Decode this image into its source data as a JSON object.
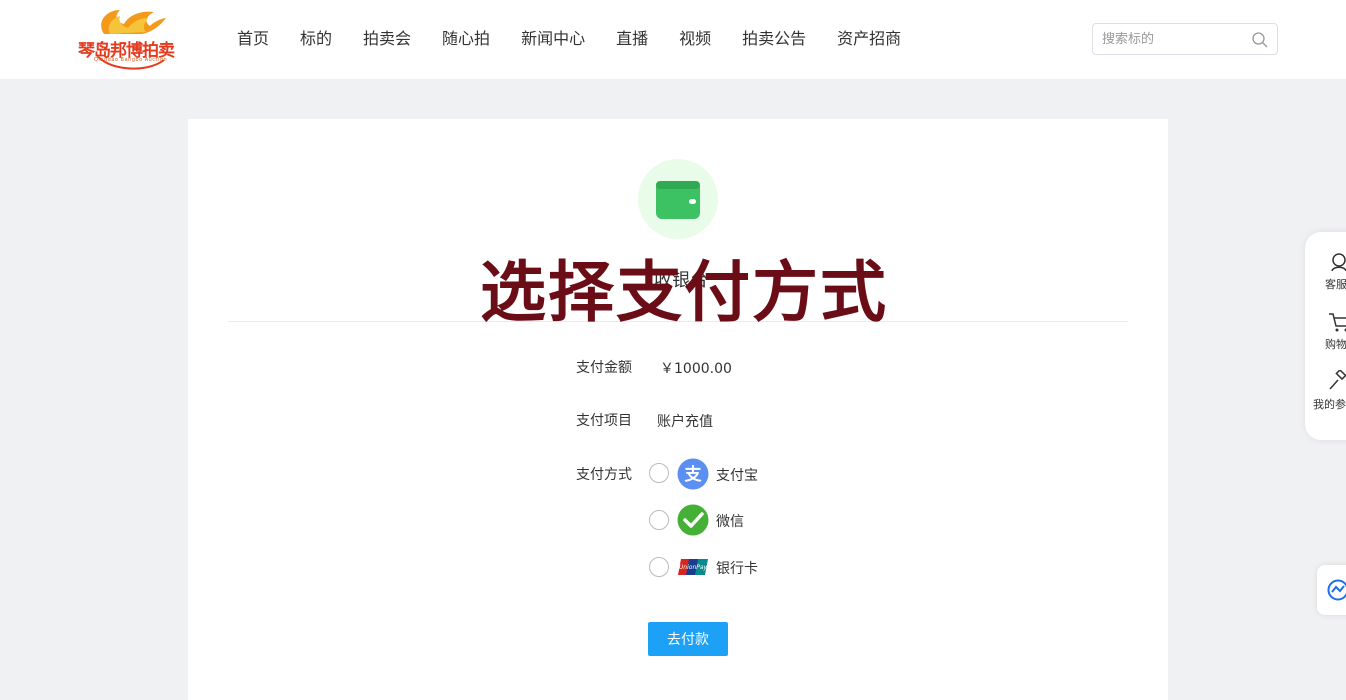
{
  "header": {
    "logo_text": "琴岛邦博拍卖",
    "logo_subtext": "Qingdao Bangbo Auction",
    "nav": [
      "首页",
      "标的",
      "拍卖会",
      "随心拍",
      "新闻中心",
      "直播",
      "视频",
      "拍卖公告",
      "资产招商"
    ],
    "search_placeholder": "搜索标的"
  },
  "cashier": {
    "title": "收银台",
    "overlay_title": "选择支付方式",
    "amount_label": "支付金额",
    "amount_value": "￥1000.00",
    "item_label": "支付项目",
    "item_value": "账户充值",
    "method_label": "支付方式",
    "methods": [
      {
        "name": "支付宝",
        "icon": "alipay-icon",
        "color": "#5b8ff2"
      },
      {
        "name": "微信",
        "icon": "wechat-icon",
        "color": "#44b035"
      },
      {
        "name": "银行卡",
        "icon": "unionpay-icon",
        "color": "#d7261e"
      }
    ],
    "pay_button": "去付款"
  },
  "sidebar": {
    "items": [
      {
        "label": "客服",
        "icon": "customer-service-icon"
      },
      {
        "label": "购物车",
        "icon": "cart-icon"
      },
      {
        "label": "我的参拍",
        "icon": "auction-hammer-icon"
      }
    ]
  },
  "colors": {
    "accent": "#1da1f7",
    "wallet_green": "#3cc163",
    "overlay_text": "#6a0d17",
    "background": "#f0f1f3"
  }
}
